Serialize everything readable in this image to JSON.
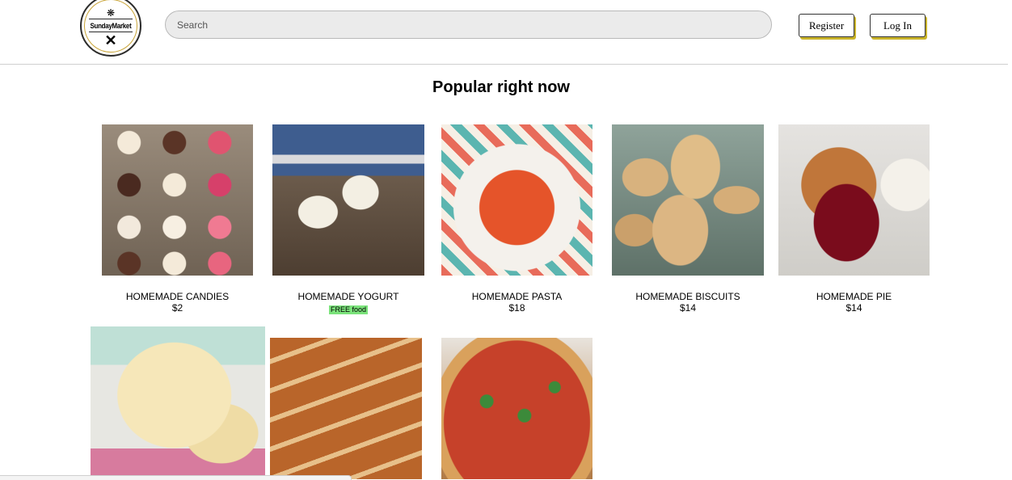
{
  "header": {
    "logo": {
      "name": "SundayMarket",
      "top_glyph": "❋",
      "utensils_glyph": "✕"
    },
    "search": {
      "placeholder": "Search",
      "value": ""
    },
    "register_label": "Register",
    "login_label": "Log In",
    "accent_color": "#c9b32a"
  },
  "main": {
    "title": "Popular right now",
    "products": [
      {
        "name": "HOMEMADE CANDIES",
        "price": "$2"
      },
      {
        "name": "HOMEMADE YOGURT",
        "price": "",
        "badge": "FREE food"
      },
      {
        "name": "HOMEMADE PASTA",
        "price": "$18"
      },
      {
        "name": "HOMEMADE BISCUITS",
        "price": "$14"
      },
      {
        "name": "HOMEMADE PIE",
        "price": "$14"
      },
      {
        "name": "",
        "price": "",
        "image": "ice-cream"
      },
      {
        "name": "",
        "price": "",
        "image": "bread"
      },
      {
        "name": "",
        "price": "",
        "image": "pizza"
      }
    ],
    "badge_color": "#7be37b"
  }
}
